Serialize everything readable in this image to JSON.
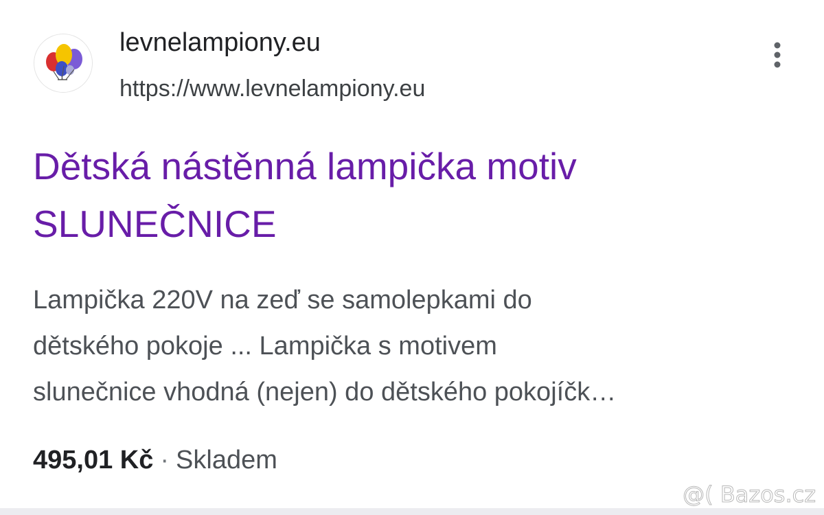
{
  "result": {
    "favicon_icon": "balloons-logo-icon",
    "site_name": "levnelampiony.eu",
    "site_url": "https://www.levnelampiony.eu",
    "more_options_icon": "more-vert-icon",
    "title": "Dětská nástěnná lampička motiv SLUNEČNICE",
    "snippet_lines": [
      "Lampička 220V na zeď se samolepkami do",
      "dětského pokoje ... Lampička s motivem",
      "slunečnice vhodná (nejen) do dětského pokojíčk…"
    ],
    "price": "495,01 Kč",
    "separator": "·",
    "availability": "Skladem"
  },
  "watermark": "@( Bazos.cz",
  "colors": {
    "title_visited": "#681da8",
    "site_name": "#202124",
    "snippet_text": "#4d5156"
  }
}
